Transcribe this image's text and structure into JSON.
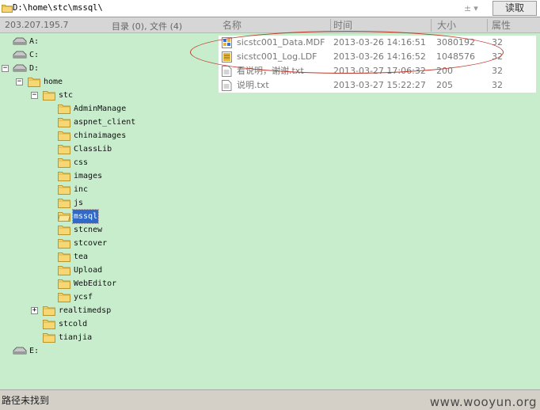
{
  "topbar": {
    "path_value": "D:\\home\\stc\\mssql\\",
    "updown_icon": "up-down-arrows-icon",
    "read_label": "读取"
  },
  "infobar": {
    "ip": "203.207.195.7",
    "counts": "目录 (0), 文件 (4)"
  },
  "columns": [
    "名称",
    "时间",
    "大小",
    "属性"
  ],
  "tree": [
    {
      "label": "A:",
      "type": "drive",
      "depth": 0
    },
    {
      "label": "C:",
      "type": "drive",
      "depth": 0
    },
    {
      "label": "D:",
      "type": "drive",
      "depth": 0,
      "expanded": true
    },
    {
      "label": "home",
      "type": "folder",
      "depth": 1,
      "expanded": true
    },
    {
      "label": "stc",
      "type": "folder",
      "depth": 2,
      "expanded": true
    },
    {
      "label": "AdminManage",
      "type": "folder",
      "depth": 3
    },
    {
      "label": "aspnet_client",
      "type": "folder",
      "depth": 3
    },
    {
      "label": "chinaimages",
      "type": "folder",
      "depth": 3
    },
    {
      "label": "ClassLib",
      "type": "folder",
      "depth": 3
    },
    {
      "label": "css",
      "type": "folder",
      "depth": 3
    },
    {
      "label": "images",
      "type": "folder",
      "depth": 3
    },
    {
      "label": "inc",
      "type": "folder",
      "depth": 3
    },
    {
      "label": "js",
      "type": "folder",
      "depth": 3
    },
    {
      "label": "mssql",
      "type": "folder",
      "depth": 3,
      "selected": true
    },
    {
      "label": "stcnew",
      "type": "folder",
      "depth": 3
    },
    {
      "label": "stcover",
      "type": "folder",
      "depth": 3
    },
    {
      "label": "tea",
      "type": "folder",
      "depth": 3
    },
    {
      "label": "Upload",
      "type": "folder",
      "depth": 3
    },
    {
      "label": "WebEditor",
      "type": "folder",
      "depth": 3
    },
    {
      "label": "ycsf",
      "type": "folder",
      "depth": 3
    },
    {
      "label": "realtimedsp",
      "type": "folder",
      "depth": 2,
      "collapsed": true
    },
    {
      "label": "stcold",
      "type": "folder",
      "depth": 2
    },
    {
      "label": "tianjia",
      "type": "folder",
      "depth": 2
    },
    {
      "label": "E:",
      "type": "drive",
      "depth": 0
    }
  ],
  "files": [
    {
      "name": "sicstc001_Data.MDF",
      "time": "2013-03-26 14:16:51",
      "size": "3080192",
      "attr": "32",
      "icon": "mdf-file-icon"
    },
    {
      "name": "sicstc001_Log.LDF",
      "time": "2013-03-26 14:16:52",
      "size": "1048576",
      "attr": "32",
      "icon": "ldf-file-icon"
    },
    {
      "name": "看说明，谢谢.txt",
      "time": "2013-03-27 17:06:32",
      "size": "200",
      "attr": "32",
      "icon": "text-file-icon"
    },
    {
      "name": "说明.txt",
      "time": "2013-03-27 15:22:27",
      "size": "205",
      "attr": "32",
      "icon": "text-file-icon"
    }
  ],
  "statusbar": {
    "message": "路径未找到",
    "watermark": "www.wooyun.org"
  },
  "colors": {
    "background": "#c7edcc",
    "selection": "#3169c6",
    "annotation": "#c0392b"
  }
}
